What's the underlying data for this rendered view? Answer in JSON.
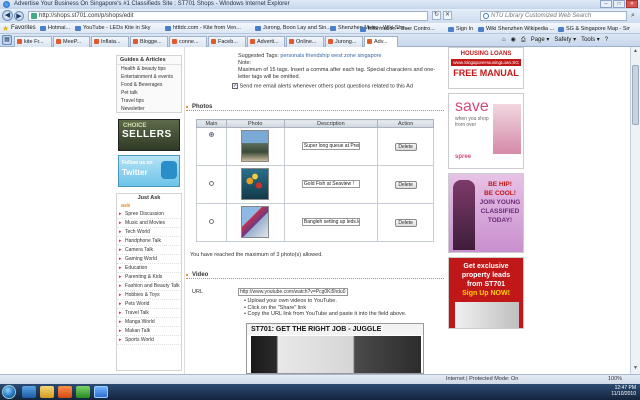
{
  "window": {
    "title": "Advertise Your Business On Singapore's #1 Classifieds Site : ST701 Shops - Windows Internet Explorer",
    "controls": [
      "–",
      "□",
      "✕"
    ]
  },
  "address": {
    "url": "http://shops.st701.com/p/shops/edit",
    "search_placeholder": "NTU Library Customized Web Search"
  },
  "favorites": {
    "label": "Favorites",
    "links": [
      "Hotmai...",
      "YouTube - LEDs Kite in Sky",
      "htttdc.com - Kite from Ven...",
      "Jurong, Boon Lay and Sin...",
      "Shenzhen Metro : Wiki She...",
      "Information • User Contro...",
      "Sign In",
      "Wiki Shenzhen Wikipedia ...",
      "SG & Singapore Map - Sin..."
    ]
  },
  "tabs": [
    {
      "label": "kite Fr..."
    },
    {
      "label": "MeeP..."
    },
    {
      "label": "Inflata..."
    },
    {
      "label": "Blogge..."
    },
    {
      "label": "conne..."
    },
    {
      "label": "Faceb..."
    },
    {
      "label": "Adverti..."
    },
    {
      "label": "Online..."
    },
    {
      "label": "Jurong..."
    },
    {
      "label": "Adv..."
    }
  ],
  "tab_tools": {
    "page": "Page ▾",
    "safety": "Safety ▾",
    "tools": "Tools ▾",
    "help": "?"
  },
  "sidebar": {
    "guides_head": "Guides & Articles",
    "guides": [
      "Health & beauty tips",
      "Entertainment & events",
      "Food & Beverages",
      "Pet talk",
      "Travel tips",
      "Newsletter"
    ],
    "choice_label": "CHOICE",
    "sellers_label": "SELLERS",
    "twitter_follow": "Follow us on",
    "twitter_name": "Twitter",
    "justask_head": "Just Ask",
    "ask_badge": "ask",
    "forums": [
      "Spree Discussion",
      "Music and Movies",
      "Tech World",
      "Handphone Talk",
      "Camera Talk",
      "Gaming World",
      "Education",
      "Parenting & Kids",
      "Fashion and Beauty Talk",
      "Hobbies & Toys",
      "Pets World",
      "Travel Talk",
      "Manga World",
      "Makan Talk",
      "Sports World"
    ]
  },
  "main": {
    "tags": {
      "suggested_label": "Suggested Tags:",
      "suggested_values": "personals friendship west zone singapore",
      "note_label": "Note:",
      "note_text": "Maximum of 15 tags. Insert a comma after each tag. Special characters and one-letter tags will be omitted."
    },
    "email_alert": "Send me email alerts whenever others post questions related to this Ad",
    "photos_title": "Photos",
    "photo_headers": [
      "Main",
      "Photo",
      "Description",
      "Action"
    ],
    "photos": [
      {
        "description": "Super long queue at Prem",
        "action": "Delete",
        "main": true
      },
      {
        "description": "Gold Fish at Seaview !",
        "action": "Delete",
        "main": false
      },
      {
        "description": "Bangleh setting up leds.kg",
        "action": "Delete",
        "main": false
      }
    ],
    "photo_limit": "You have reached the maximum of 3 photo(s) allowed.",
    "video_title": "Video",
    "url_label": "URL",
    "url_value": "http://www.youtube.com/watch?v=Pcg0Ki5hdu0",
    "video_steps": [
      "Upload your own videos to YouTube.",
      "Click on the \"Share\" link",
      "Copy the URL link from YouTube and paste it into the field above."
    ],
    "video_banner": "ST701: GET THE RIGHT JOB - JUGGLE"
  },
  "ads": {
    "ad1_line": "www.SingaporeHousingLoan.SG",
    "ad1_bottom": "FREE MANUAL",
    "ad1_top": "HOUSING LOANS",
    "ad2_big": "save",
    "ad2_small": "when you shop from over",
    "ad2_brand": "spree",
    "ad3_lines": [
      "BE HIP!",
      "BE COOL!",
      "JOIN YOUNG",
      "CLASSIFIED",
      "TODAY!"
    ],
    "ad4_lines": [
      "Get exclusive",
      "property leads",
      "from ST701",
      "Sign Up NOW!"
    ]
  },
  "status": {
    "zone": "Internet | Protected Mode: On",
    "zoom": "100%"
  },
  "taskbar": {
    "time": "12:47 PM",
    "date": "11/10/2010"
  },
  "colors": {
    "accent": "#e08e2a",
    "ad_red": "#c01818",
    "twitter_blue": "#3aa3dd"
  }
}
